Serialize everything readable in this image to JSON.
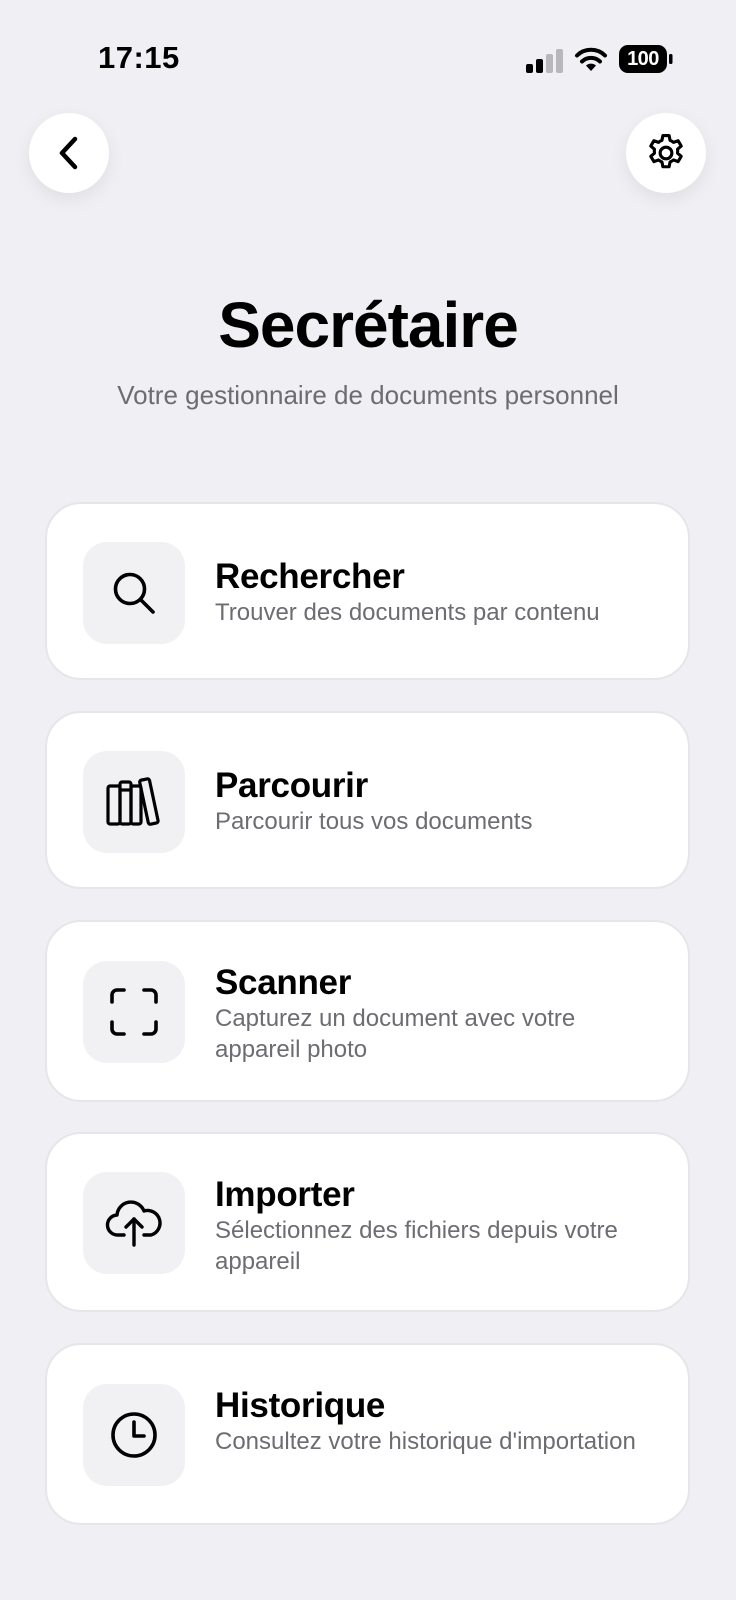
{
  "status_bar": {
    "time": "17:15",
    "battery": "100",
    "icons": [
      "signal-icon",
      "wifi-icon",
      "battery-icon"
    ]
  },
  "nav": {
    "back_icon": "chevron-left-icon",
    "settings_icon": "gear-icon"
  },
  "header": {
    "title": "Secrétaire",
    "subtitle": "Votre gestionnaire de documents personnel"
  },
  "menu": [
    {
      "icon": "search-icon",
      "title": "Rechercher",
      "description": "Trouver des documents par contenu"
    },
    {
      "icon": "books-icon",
      "title": "Parcourir",
      "description": "Parcourir tous vos documents"
    },
    {
      "icon": "scan-icon",
      "title": "Scanner",
      "description": "Capturez un document avec votre appareil photo"
    },
    {
      "icon": "cloud-upload-icon",
      "title": "Importer",
      "description": "Sélectionnez des fichiers depuis votre appareil"
    },
    {
      "icon": "clock-icon",
      "title": "Historique",
      "description": "Consultez votre historique d'importation"
    }
  ],
  "colors": {
    "background": "#f0f0f4",
    "card": "#ffffff",
    "icon_tile": "#f1f1f4",
    "secondary_text": "#6c6c72"
  }
}
